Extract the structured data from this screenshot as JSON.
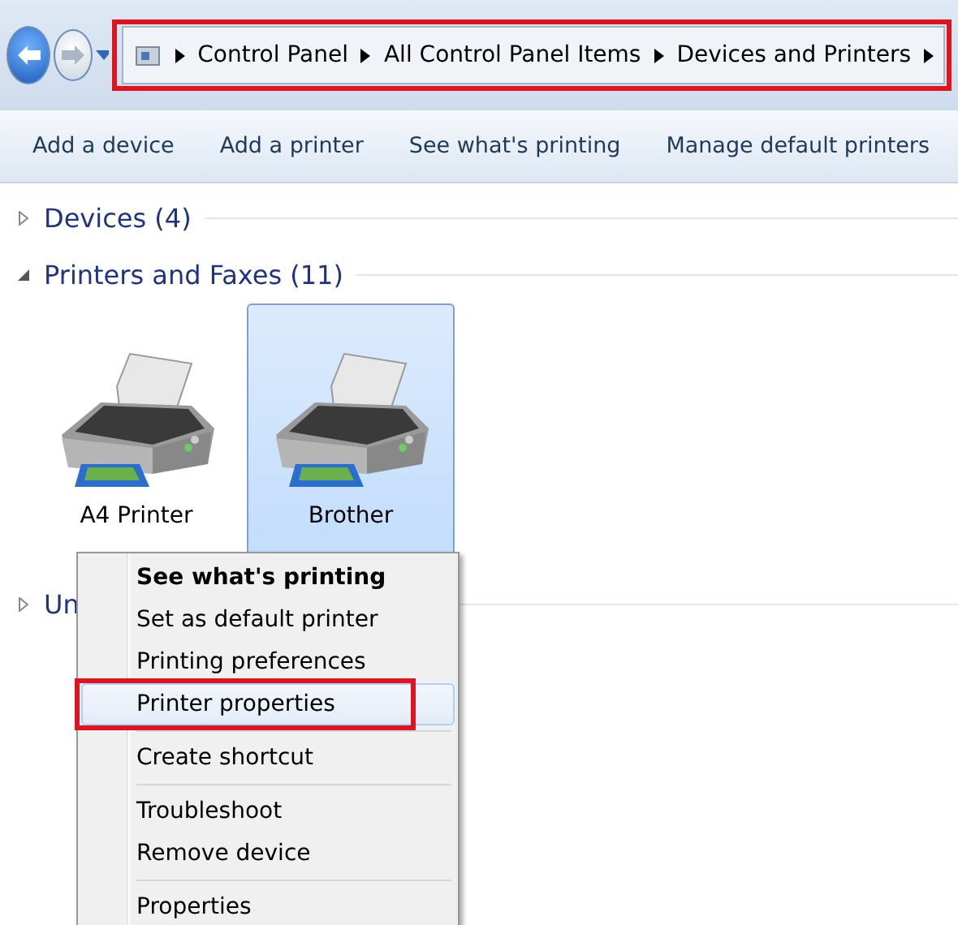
{
  "navigation": {
    "back_enabled": true,
    "forward_enabled": false
  },
  "address_bar": {
    "framed": true,
    "crumbs": [
      "Control Panel",
      "All Control Panel Items",
      "Devices and Printers"
    ]
  },
  "toolbar": [
    "Add a device",
    "Add a printer",
    "See what's printing",
    "Manage default printers"
  ],
  "groups": [
    {
      "title": "Devices (4)",
      "expanded": false
    },
    {
      "title": "Printers and Faxes (11)",
      "expanded": true,
      "items": [
        {
          "label": "A4 Printer",
          "selected": false
        },
        {
          "label": "Brother",
          "selected": true
        }
      ]
    },
    {
      "title": "Un",
      "expanded": false
    }
  ],
  "context_menu": [
    [
      {
        "label": "See what's printing",
        "bold": true,
        "selected": false,
        "framed": false
      },
      {
        "label": "Set as default printer",
        "bold": false,
        "selected": false,
        "framed": false
      },
      {
        "label": "Printing preferences",
        "bold": false,
        "selected": false,
        "framed": false
      },
      {
        "label": "Printer properties",
        "bold": false,
        "selected": true,
        "framed": true
      }
    ],
    [
      {
        "label": "Create shortcut",
        "bold": false,
        "selected": false,
        "framed": false
      }
    ],
    [
      {
        "label": "Troubleshoot",
        "bold": false,
        "selected": false,
        "framed": false
      },
      {
        "label": "Remove device",
        "bold": false,
        "selected": false,
        "framed": false
      }
    ],
    [
      {
        "label": "Properties",
        "bold": false,
        "selected": false,
        "framed": false
      }
    ]
  ]
}
